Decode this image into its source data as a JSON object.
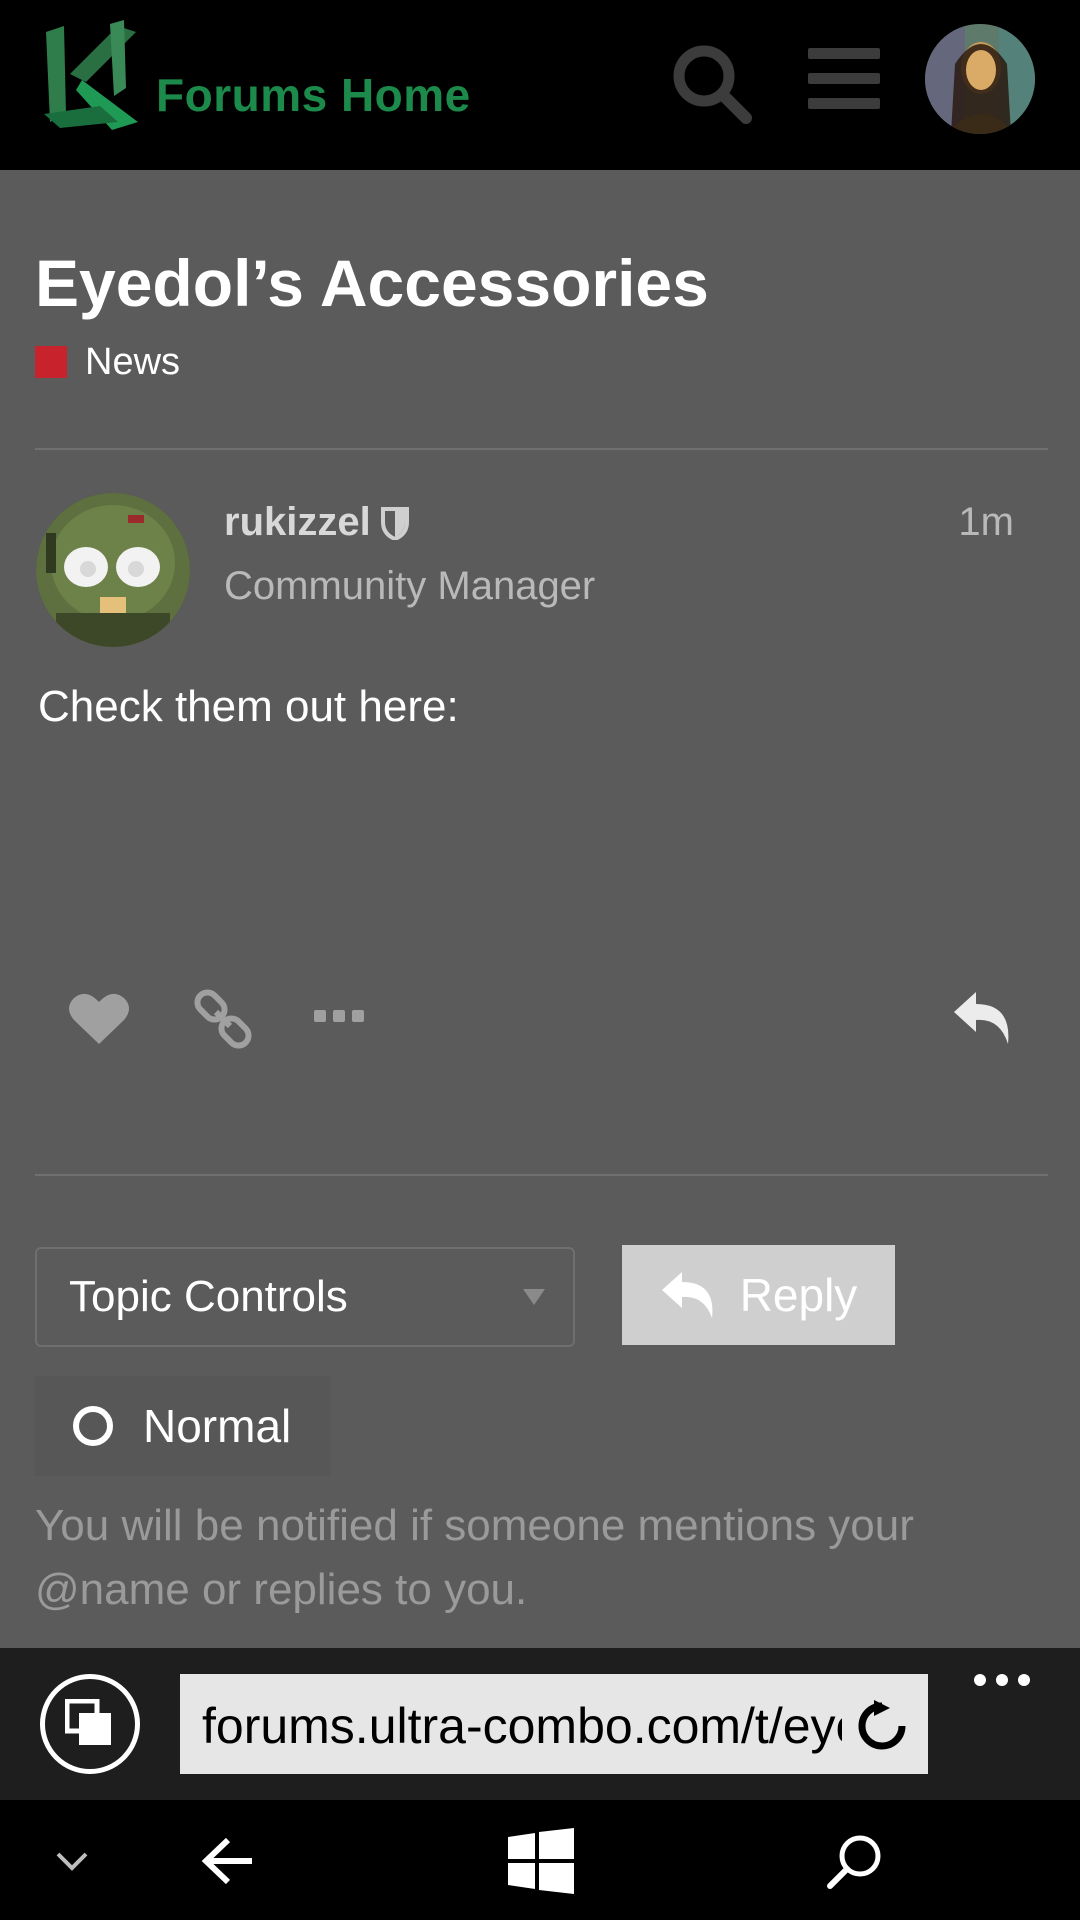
{
  "header": {
    "logo_text": "Forums Home",
    "icons": [
      "search-icon",
      "hamburger-menu-icon"
    ]
  },
  "topic": {
    "title": "Eyedol’s Accessories",
    "category": {
      "label": "News",
      "color": "#c8232c"
    }
  },
  "post": {
    "username": "rukizzel",
    "user_title": "Community Manager",
    "age": "1m",
    "body": "Check them out here:",
    "actions": [
      "heart-icon",
      "link-icon",
      "more-icon",
      "reply-icon"
    ]
  },
  "controls": {
    "topic_controls_label": "Topic Controls",
    "reply_label": "Reply",
    "notification_level": "Normal",
    "notification_description": "You will be notified if someone mentions your @name or replies to you."
  },
  "browser": {
    "url": "forums.ultra-combo.com/t/eyedols-accessories"
  },
  "colors": {
    "header_bg": "#000000",
    "content_bg": "#5b5b5b",
    "logo_green": "#1c8a4a",
    "reply_button_bg": "#cfcfcf",
    "browser_bar_bg": "#1e1e1e"
  }
}
